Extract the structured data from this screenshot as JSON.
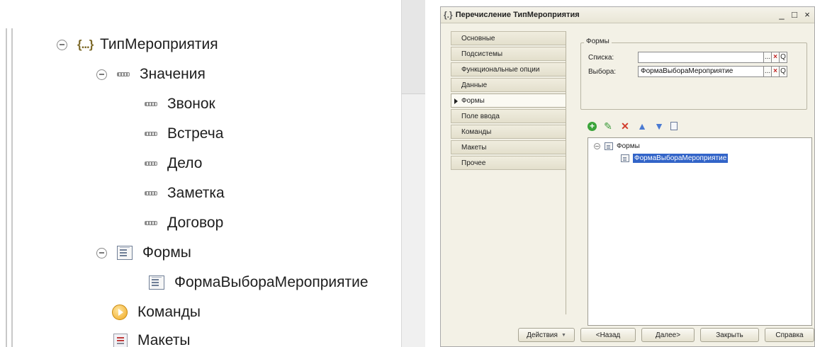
{
  "tree": {
    "root": "ТипМероприятия",
    "values_node": "Значения",
    "values": [
      "Звонок",
      "Встреча",
      "Дело",
      "Заметка",
      "Договор"
    ],
    "forms_node": "Формы",
    "forms": [
      "ФормаВыбораМероприятие"
    ],
    "commands_node": "Команды",
    "templates_node": "Макеты"
  },
  "dialog": {
    "title": "Перечисление ТипМероприятия",
    "window_buttons": {
      "minimize": "_",
      "maximize": "□",
      "close": "×"
    },
    "tabs": [
      "Основные",
      "Подсистемы",
      "Функциональные опции",
      "Данные",
      "Формы",
      "Поле ввода",
      "Команды",
      "Макеты",
      "Прочее"
    ],
    "active_tab": "Формы",
    "forms_group": {
      "title": "Формы",
      "list_label": "Списка:",
      "list_value": "",
      "choice_label": "Выбора:",
      "choice_value": "ФормаВыбораМероприятие",
      "field_buttons": {
        "open": "...",
        "clear": "×",
        "search": "Q"
      }
    },
    "toolbar": {
      "add": "+",
      "edit": "✎",
      "delete": "✕",
      "up": "▲",
      "down": "▼"
    },
    "forms_tree": {
      "root": "Формы",
      "item": "ФормаВыбораМероприятие"
    },
    "buttons": {
      "actions": "Действия",
      "back": "<Назад",
      "next": "Далее>",
      "close": "Закрыть",
      "help": "Справка"
    }
  }
}
